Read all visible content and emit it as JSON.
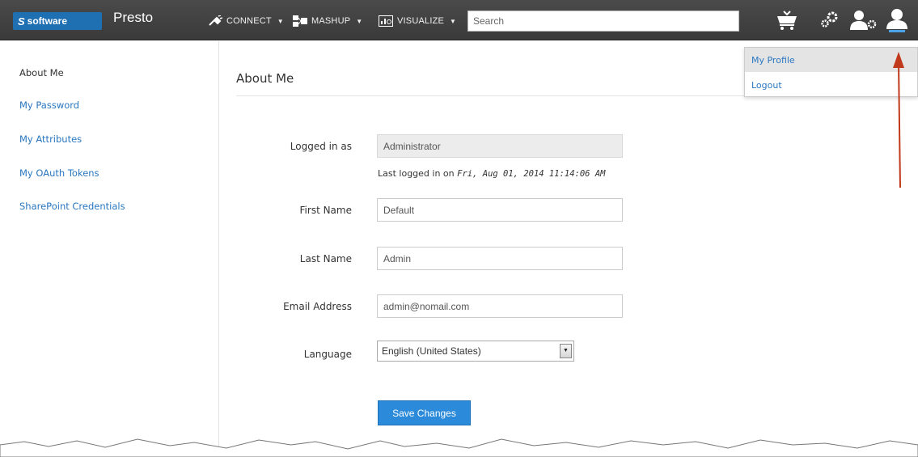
{
  "header": {
    "logo_text": "software",
    "app_name": "Presto",
    "nav": [
      {
        "label": "CONNECT",
        "icon": "connect-plug-icon"
      },
      {
        "label": "MASHUP",
        "icon": "mashup-icon"
      },
      {
        "label": "VISUALIZE",
        "icon": "visualize-chart-icon"
      }
    ],
    "search_placeholder": "Search",
    "icons": [
      "cart-icon",
      "gears-icon",
      "admin-user-icon",
      "user-profile-icon"
    ]
  },
  "sidebar": {
    "items": [
      {
        "label": "About Me",
        "active": true
      },
      {
        "label": "My Password",
        "active": false
      },
      {
        "label": "My Attributes",
        "active": false
      },
      {
        "label": "My OAuth Tokens",
        "active": false
      },
      {
        "label": "SharePoint Credentials",
        "active": false
      }
    ]
  },
  "main": {
    "title": "About Me",
    "fields": {
      "logged_in_label": "Logged in as",
      "logged_in_value": "Administrator",
      "last_login_prefix": "Last logged in on",
      "last_login_value": "Fri, Aug 01, 2014 11:14:06 AM",
      "first_name_label": "First Name",
      "first_name_value": "Default",
      "last_name_label": "Last Name",
      "last_name_value": "Admin",
      "email_label": "Email Address",
      "email_value": "admin@nomail.com",
      "language_label": "Language",
      "language_value": "English (United States)"
    },
    "save_label": "Save Changes"
  },
  "user_menu": {
    "items": [
      {
        "label": "My Profile",
        "highlighted": true
      },
      {
        "label": "Logout",
        "highlighted": false
      }
    ]
  },
  "colors": {
    "topbar": "#3f3f3f",
    "link": "#2a77c0",
    "primary_button": "#2b8ad9",
    "annotation_arrow": "#c0391b"
  }
}
